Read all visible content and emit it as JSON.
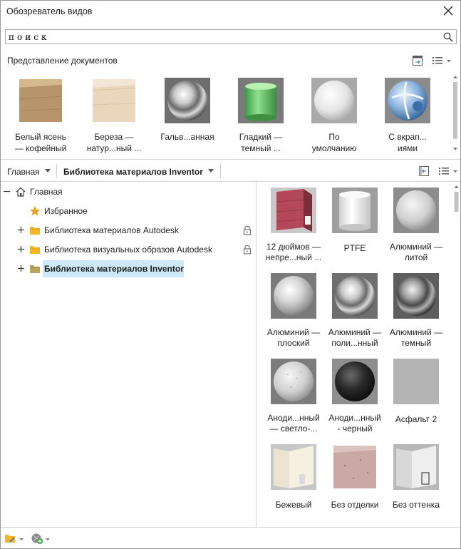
{
  "window": {
    "title": "Обозреватель видов"
  },
  "search": {
    "value": "поиск",
    "placeholder": ""
  },
  "documents": {
    "label": "Представление документов",
    "items": [
      {
        "line1": "Белый ясень",
        "line2": "— кофейный",
        "icon": "wood-cube"
      },
      {
        "line1": "Береза —",
        "line2": "натур...ный ...",
        "icon": "light-wood-cube"
      },
      {
        "line1": "Гальв...анная",
        "line2": "",
        "icon": "chrome-sphere"
      },
      {
        "line1": "Гладкий —",
        "line2": "темный ...",
        "icon": "green-cylinder"
      },
      {
        "line1": "По",
        "line2": "умолчанию",
        "icon": "white-sphere"
      },
      {
        "line1": "С вкрап...",
        "line2": "иями",
        "icon": "blue-ceramic-sphere"
      }
    ]
  },
  "breadcrumb": {
    "home": "Главная",
    "current": "Библиотека материалов Inventor"
  },
  "tree": {
    "items": [
      {
        "label": "Главная",
        "icon": "home-icon",
        "expander": "minus",
        "locked": false
      },
      {
        "label": "Избранное",
        "icon": "star-icon",
        "expander": "",
        "locked": false
      },
      {
        "label": "Библиотека материалов Autodesk",
        "icon": "folder-icon",
        "expander": "plus",
        "locked": true
      },
      {
        "label": "Библиотека визуальных образов Autodesk",
        "icon": "folder-icon",
        "expander": "plus",
        "locked": true
      },
      {
        "label": "Библиотека материалов Inventor",
        "icon": "folder-icon",
        "expander": "plus",
        "locked": false,
        "selected": true
      }
    ]
  },
  "library": {
    "items": [
      {
        "line1": "12 дюймов —",
        "line2": "непре...ный ...",
        "icon": "red-wall-swatch"
      },
      {
        "line1": "PTFE",
        "line2": "",
        "icon": "white-cylinder"
      },
      {
        "line1": "Алюминий —",
        "line2": "литой",
        "icon": "matte-sphere"
      },
      {
        "line1": "Алюминий —",
        "line2": "плоский",
        "icon": "satin-sphere"
      },
      {
        "line1": "Алюминий —",
        "line2": "поли...нный",
        "icon": "polished-sphere"
      },
      {
        "line1": "Алюминий —",
        "line2": "темный",
        "icon": "dark-chrome-sphere"
      },
      {
        "line1": "Аноди...нный",
        "line2": "— светло-...",
        "icon": "textured-sphere"
      },
      {
        "line1": "Аноди...нный",
        "line2": "- черный",
        "icon": "black-sphere"
      },
      {
        "line1": "Асфальт 2",
        "line2": "",
        "icon": "gray-square"
      },
      {
        "line1": "Бежевый",
        "line2": "",
        "icon": "beige-wall-swatch"
      },
      {
        "line1": "Без отделки",
        "line2": "",
        "icon": "granite-cube"
      },
      {
        "line1": "Без оттенка",
        "line2": "",
        "icon": "glass-wall-swatch"
      }
    ]
  },
  "colors": {
    "folder": "#f5b52a",
    "selected": "#cde8f7",
    "star": "#f0a020"
  }
}
